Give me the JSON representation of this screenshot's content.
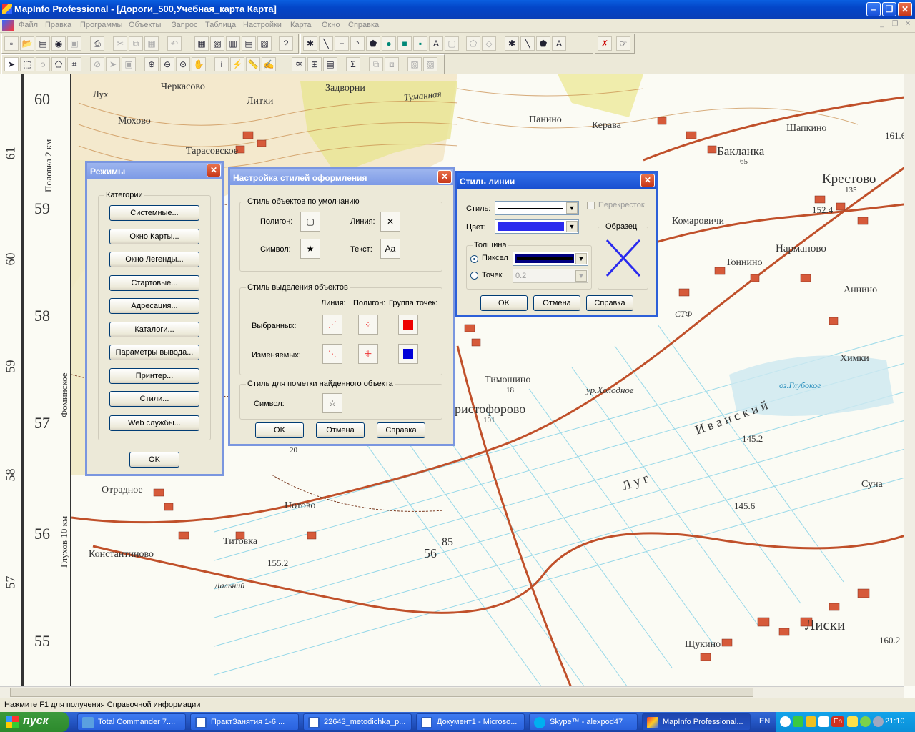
{
  "window": {
    "title": "MapInfo Professional - [Дороги_500,Учебная_карта Карта]"
  },
  "menu": [
    "Файл",
    "Правка",
    "Программы",
    "Объекты",
    "Запрос",
    "Таблица",
    "Настройки",
    "Карта",
    "Окно",
    "Справка"
  ],
  "map": {
    "grid_numbers": [
      "60",
      "59",
      "58",
      "57",
      "56",
      "55"
    ],
    "rotated_grid": [
      "61",
      "60",
      "59",
      "58",
      "57"
    ],
    "labels": {
      "luh": "Лух",
      "mohovo": "Мохово",
      "cherkasovo": "Черкасово",
      "litki": "Литки",
      "zadvorni": "Задворни",
      "tumannaya": "Туманная",
      "panino": "Панино",
      "kerava": "Керава",
      "shapkino": "Шапкино",
      "baklanka": "Бакланка",
      "krestovo": "Крестово",
      "tarasovskoe": "Тарасовское",
      "komarovichi": "Комаровичи",
      "narmanovo": "Нарманово",
      "tonnino": "Тоннино",
      "annino": "Аннино",
      "khimki": "Химки",
      "timoshino": "Тимошино",
      "kholodnoe": "ур.Холодное",
      "khristoforovo": "ристофорово",
      "otradnoe": "Отрадное",
      "notovo": "Нотово",
      "titovka": "Титовка",
      "konstantinovo": "Константиново",
      "dalniy": "Дальний",
      "liski": "Лиски",
      "shchukino": "Щукино",
      "suna": "Суна",
      "stf": "СТФ",
      "polovka": "Половка 2 км",
      "fominskoe": "Фоминское",
      "glukhov": "Глухов 10 км",
      "ozero": "оз.Глубокое",
      "ivanskiy": "И в а н с к и й",
      "v145_2": "145.2",
      "v145_6": "145.6",
      "v155_2": "155.2",
      "v161_6": "161.6",
      "v152": "152.4",
      "v160_2": "160.2",
      "n56": "56",
      "n85": "85",
      "n101": "101",
      "n18": "18",
      "n20": "20",
      "n65": "65",
      "n135": "135",
      "lugl": "Л у г"
    }
  },
  "dlg_modes": {
    "title": "Режимы",
    "group": "Категории",
    "buttons": [
      "Системные...",
      "Окно Карты...",
      "Окно Легенды...",
      "Стартовые...",
      "Адресация...",
      "Каталоги...",
      "Параметры вывода...",
      "Принтер...",
      "Стили...",
      "Web службы..."
    ],
    "ok": "OK"
  },
  "dlg_styles": {
    "title": "Настройка стилей оформления",
    "grp_default": "Стиль объектов по умолчанию",
    "polygon": "Полигон:",
    "line": "Линия:",
    "symbol": "Символ:",
    "text": "Текст:",
    "text_sample": "Aa",
    "grp_select": "Стиль выделения объектов",
    "col_line": "Линия:",
    "col_polygon": "Полигон:",
    "col_points": "Группа точек:",
    "selected": "Выбранных:",
    "changed": "Изменяемых:",
    "grp_found": "Стиль для пометки найденного объекта",
    "symbol2": "Символ:",
    "ok": "OK",
    "cancel": "Отмена",
    "help": "Справка"
  },
  "dlg_line": {
    "title": "Стиль линии",
    "style": "Стиль:",
    "color": "Цвет:",
    "crossing": "Перекресток",
    "sample": "Образец",
    "thickness": "Толщина",
    "pixels": "Пиксел",
    "points": "Точек",
    "points_value": "0.2",
    "ok": "OK",
    "cancel": "Отмена",
    "help": "Справка",
    "line_color": "#2a2aee"
  },
  "status": "Нажмите F1 для получения Справочной информации",
  "taskbar": {
    "start": "пуск",
    "tasks": [
      "Total Commander 7....",
      "ПрактЗанятия 1-6 ...",
      "22643_metodichka_p...",
      "Документ1 - Microso...",
      "Skype™ - alexpod47",
      "MapInfo Professional..."
    ],
    "lang": "EN",
    "lang2": "En",
    "clock": "21:10"
  }
}
